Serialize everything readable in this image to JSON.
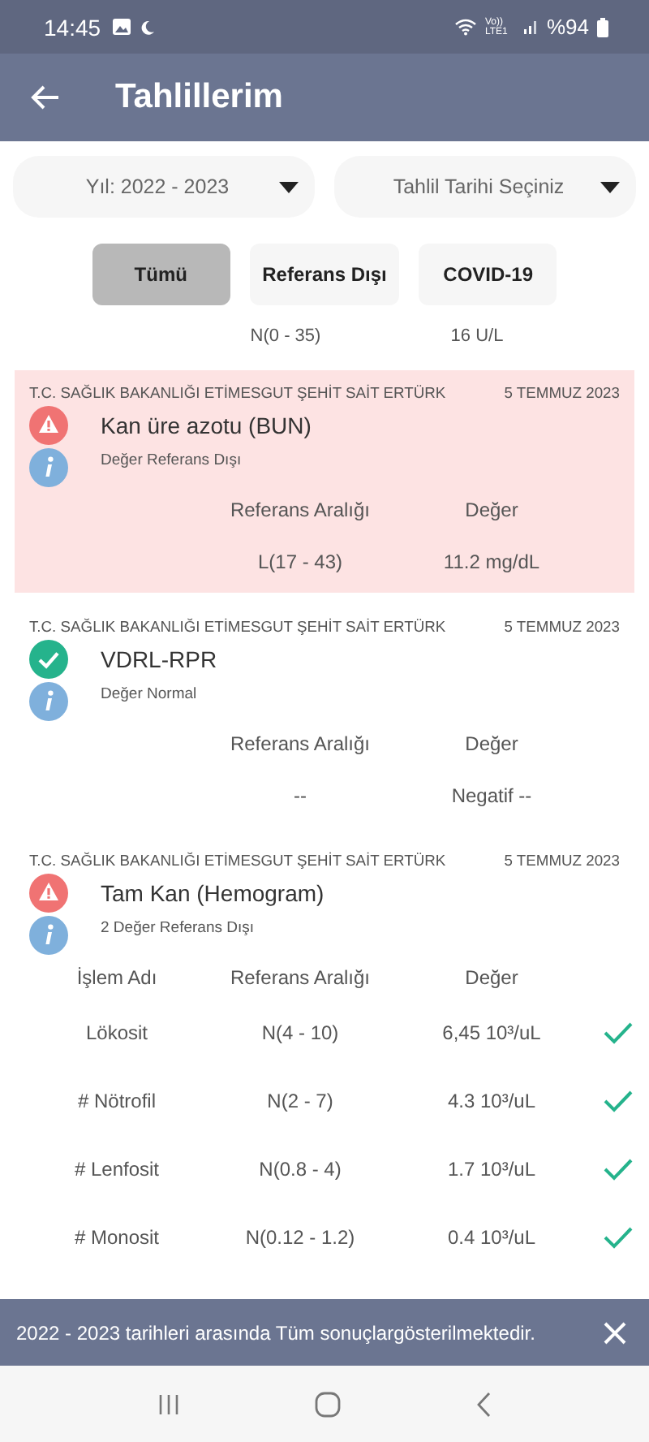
{
  "status_bar": {
    "time": "14:45",
    "network": "Vo)) LTE1",
    "battery": "%94"
  },
  "app_bar": {
    "title": "Tahlillerim"
  },
  "filters": [
    {
      "value": "Yıl: 2022 - 2023"
    },
    {
      "value": "Tahlil Tarihi Seçiniz"
    }
  ],
  "chips": [
    {
      "label": "Tümü",
      "selected": true
    },
    {
      "label": "Referans Dışı",
      "selected": false
    },
    {
      "label": "COVID-19",
      "selected": false
    }
  ],
  "partial_row": {
    "range": "N(0 - 35)",
    "value": "16 U/L"
  },
  "tests": [
    {
      "institution": "T.C. SAĞLIK BAKANLIĞI ETİMESGUT ŞEHİT SAİT ERTÜRK",
      "date": "5 TEMMUZ 2023",
      "name": "Kan üre azotu (BUN)",
      "kind": "warning",
      "highlighted": true,
      "note": "Değer Referans Dışı",
      "columns": [
        "Referans Aralığı",
        "Değer"
      ],
      "rows": [
        {
          "cells": [
            "L(17 - 43)",
            "11.2 mg/dL"
          ],
          "normal": false
        }
      ]
    },
    {
      "institution": "T.C. SAĞLIK BAKANLIĞI ETİMESGUT ŞEHİT SAİT ERTÜRK",
      "date": "5 TEMMUZ 2023",
      "name": "VDRL-RPR",
      "kind": "normal",
      "highlighted": false,
      "note": "Değer Normal",
      "columns": [
        "Referans Aralığı",
        "Değer"
      ],
      "rows": [
        {
          "cells": [
            "--",
            "Negatif --"
          ],
          "normal": false
        }
      ]
    },
    {
      "institution": "T.C. SAĞLIK BAKANLIĞI ETİMESGUT ŞEHİT SAİT ERTÜRK",
      "date": "5 TEMMUZ 2023",
      "name": "Tam Kan (Hemogram)",
      "kind": "warning",
      "highlighted": false,
      "note": "2 Değer Referans Dışı",
      "columns": [
        "İşlem Adı",
        "Referans Aralığı",
        "Değer"
      ],
      "rows": [
        {
          "cells": [
            "Lökosit",
            "N(4 - 10)",
            "6,45 10³/uL"
          ],
          "normal": true
        },
        {
          "cells": [
            "# Nötrofil",
            "N(2 - 7)",
            "4.3 10³/uL"
          ],
          "normal": true
        },
        {
          "cells": [
            "# Lenfosit",
            "N(0.8 - 4)",
            "1.7 10³/uL"
          ],
          "normal": true
        },
        {
          "cells": [
            "# Monosit",
            "N(0.12 - 1.2)",
            "0.4 10³/uL"
          ],
          "normal": true
        }
      ]
    }
  ],
  "snackbar": {
    "message": "2022 - 2023 tarihleri arasında Tüm sonuçlargösterilmektedir."
  }
}
